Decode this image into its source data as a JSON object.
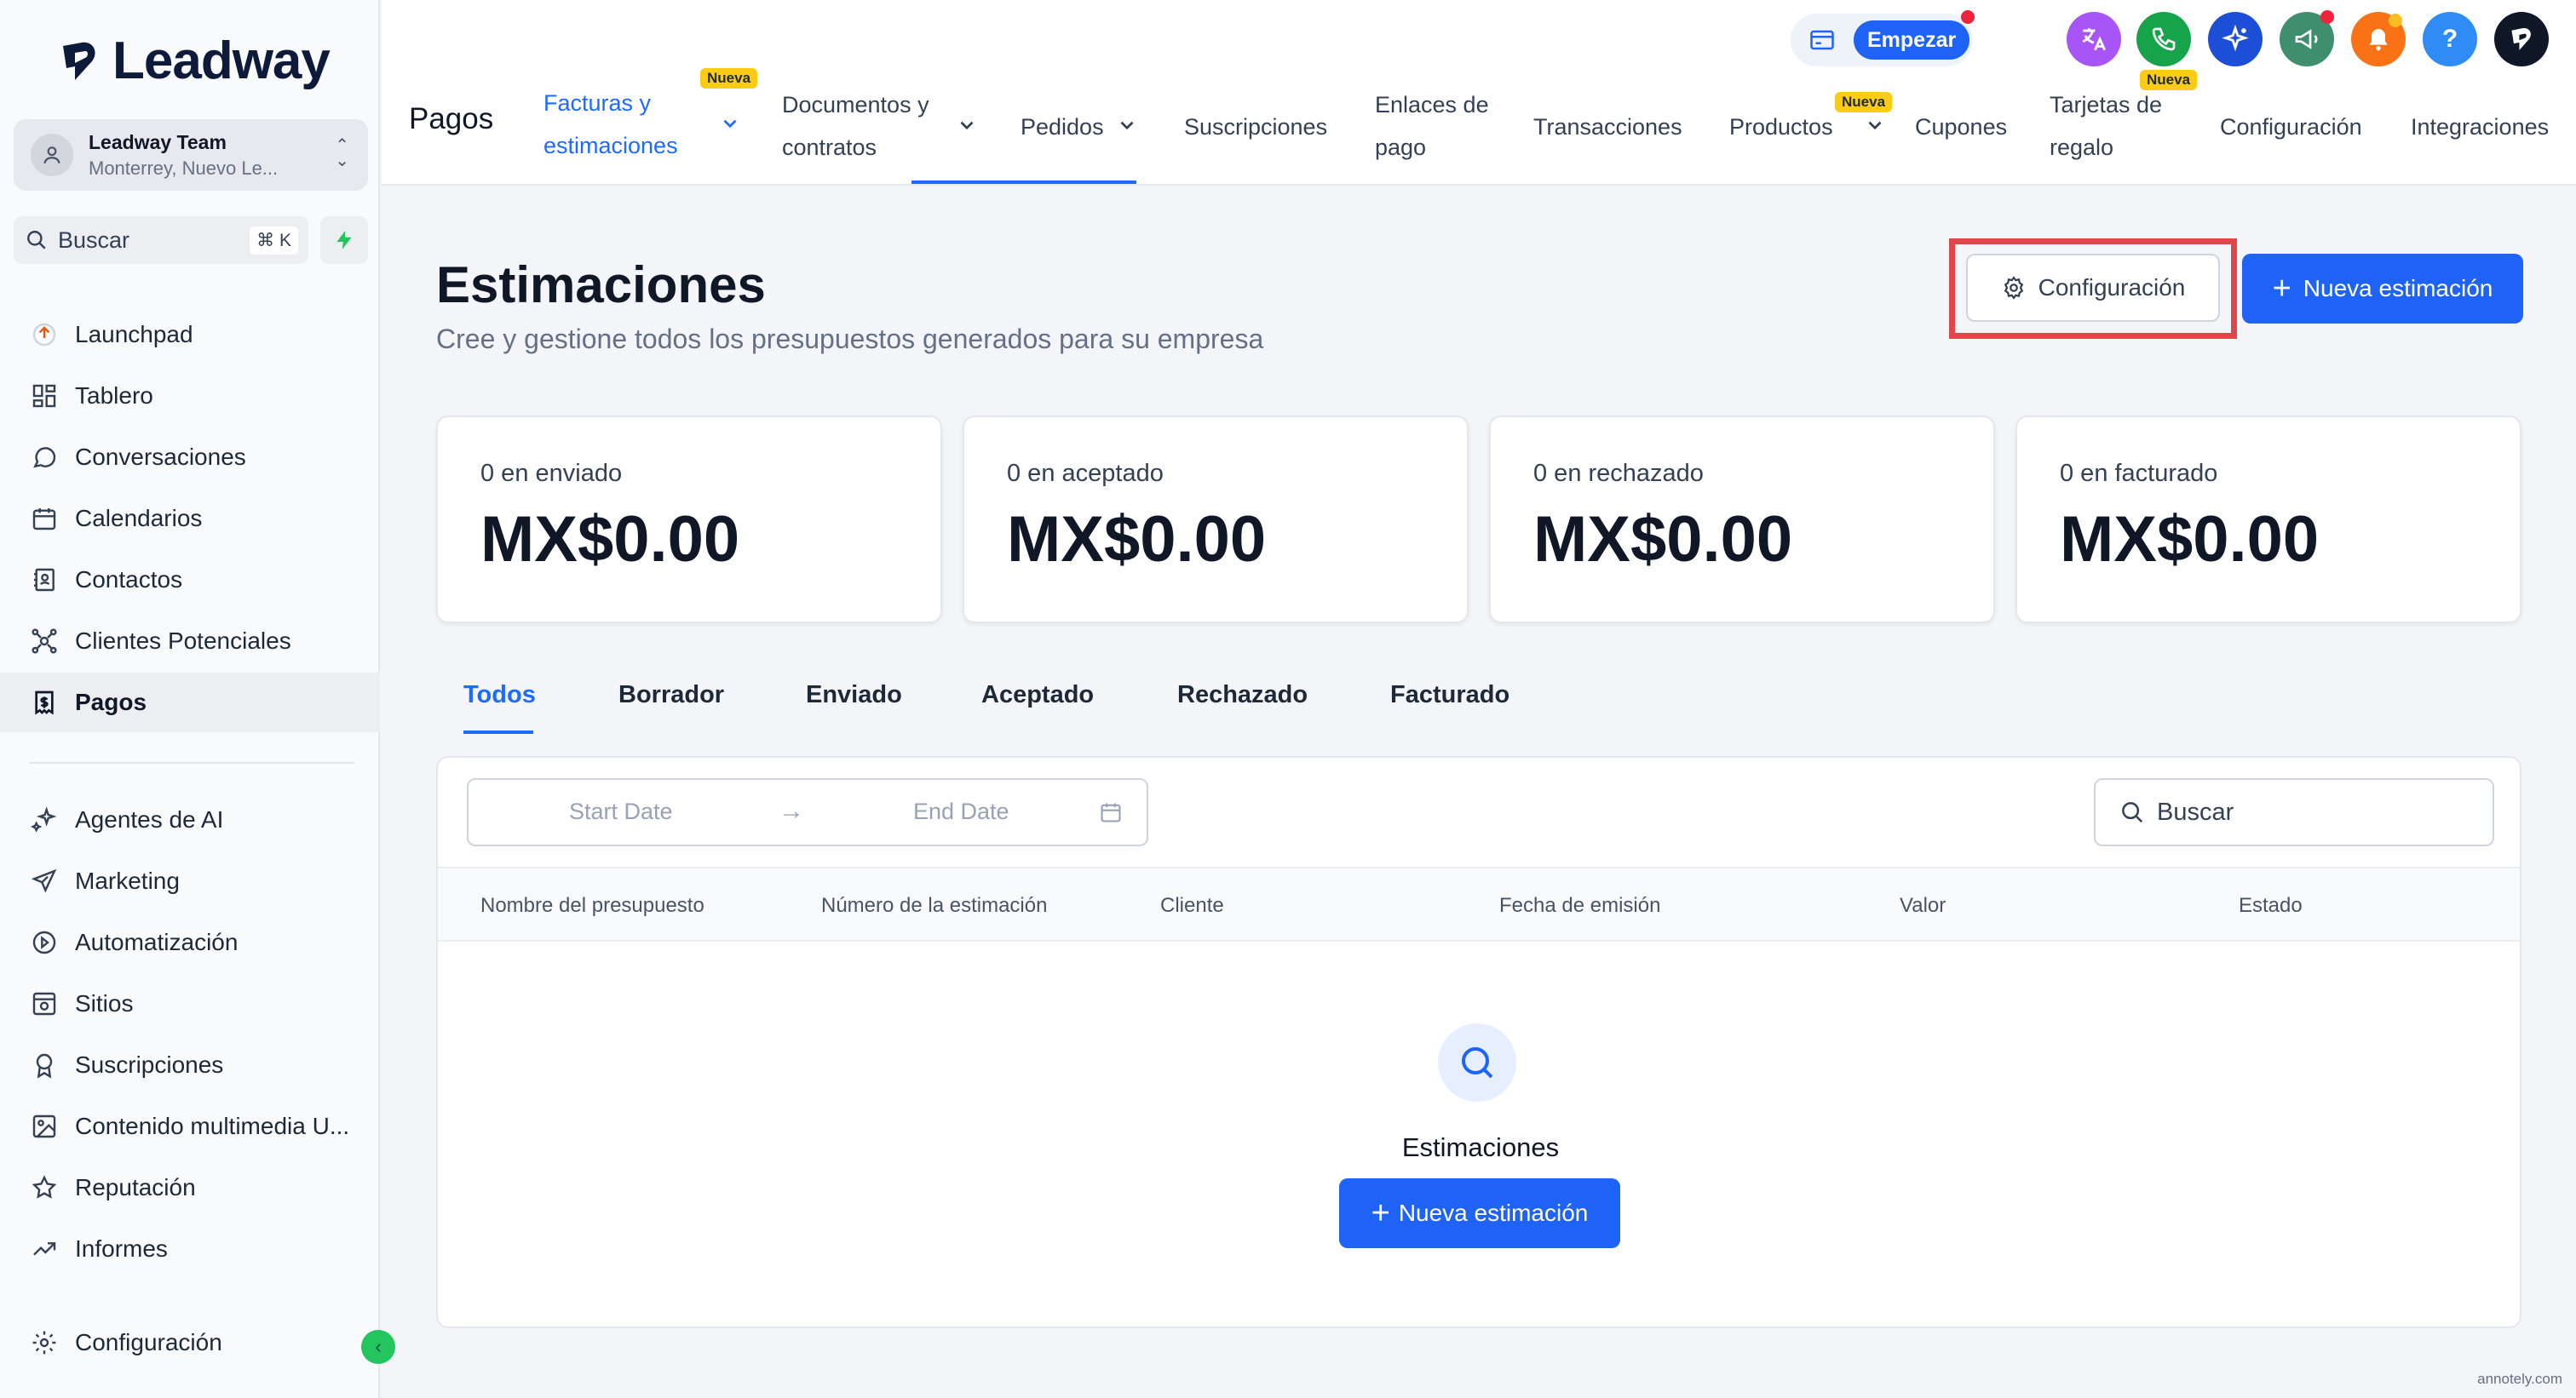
{
  "brand": {
    "name": "Leadway"
  },
  "account": {
    "name": "Leadway Team",
    "location": "Monterrey, Nuevo Le..."
  },
  "sidebar_search": {
    "placeholder": "Buscar",
    "shortcut": "⌘ K"
  },
  "sidebar": {
    "items": [
      {
        "label": "Launchpad",
        "icon": "rocket-icon"
      },
      {
        "label": "Tablero",
        "icon": "dashboard-icon"
      },
      {
        "label": "Conversaciones",
        "icon": "chat-icon"
      },
      {
        "label": "Calendarios",
        "icon": "calendar-icon"
      },
      {
        "label": "Contactos",
        "icon": "contacts-icon"
      },
      {
        "label": "Clientes Potenciales",
        "icon": "leads-icon"
      },
      {
        "label": "Pagos",
        "icon": "payments-icon",
        "active": true
      }
    ],
    "items2": [
      {
        "label": "Agentes de AI",
        "icon": "sparkle-icon"
      },
      {
        "label": "Marketing",
        "icon": "send-icon"
      },
      {
        "label": "Automatización",
        "icon": "automation-icon"
      },
      {
        "label": "Sitios",
        "icon": "sites-icon"
      },
      {
        "label": "Suscripciones",
        "icon": "badge-icon"
      },
      {
        "label": "Contenido multimedia U...",
        "icon": "image-icon"
      },
      {
        "label": "Reputación",
        "icon": "star-icon"
      },
      {
        "label": "Informes",
        "icon": "trend-icon"
      }
    ],
    "settings_label": "Configuración"
  },
  "topbar": {
    "title": "Pagos",
    "tabs": {
      "facturas_l1": "Facturas y",
      "facturas_l2": "estimaciones",
      "documentos_l1": "Documentos y",
      "documentos_l2": "contratos",
      "pedidos": "Pedidos",
      "suscripciones": "Suscripciones",
      "enlaces_l1": "Enlaces de",
      "enlaces_l2": "pago",
      "transacciones": "Transacciones",
      "productos": "Productos",
      "cupones": "Cupones",
      "tarjetas_l1": "Tarjetas de",
      "tarjetas_l2": "regalo",
      "configuracion": "Configuración",
      "integraciones": "Integraciones"
    },
    "badge_new": "Nueva",
    "empezar": "Empezar",
    "help": "?"
  },
  "page": {
    "title": "Estimaciones",
    "subtitle": "Cree y gestione todos los presupuestos generados para su empresa",
    "config_button": "Configuración",
    "new_button": "Nueva estimación"
  },
  "stats": [
    {
      "label": "0 en enviado",
      "value": "MX$0.00"
    },
    {
      "label": "0 en aceptado",
      "value": "MX$0.00"
    },
    {
      "label": "0 en rechazado",
      "value": "MX$0.00"
    },
    {
      "label": "0 en facturado",
      "value": "MX$0.00"
    }
  ],
  "filter_tabs": [
    "Todos",
    "Borrador",
    "Enviado",
    "Aceptado",
    "Rechazado",
    "Facturado"
  ],
  "table": {
    "start_placeholder": "Start Date",
    "end_placeholder": "End Date",
    "search_placeholder": "Buscar",
    "columns": [
      "Nombre del presupuesto",
      "Número de la estimación",
      "Cliente",
      "Fecha de emisión",
      "Valor",
      "Estado"
    ],
    "empty_title": "Estimaciones",
    "empty_button": "Nueva estimación"
  },
  "watermark": "annotely.com",
  "colors": {
    "accent": "#1e63f5",
    "highlight": "#e0474c",
    "new_badge": "#facc15"
  }
}
